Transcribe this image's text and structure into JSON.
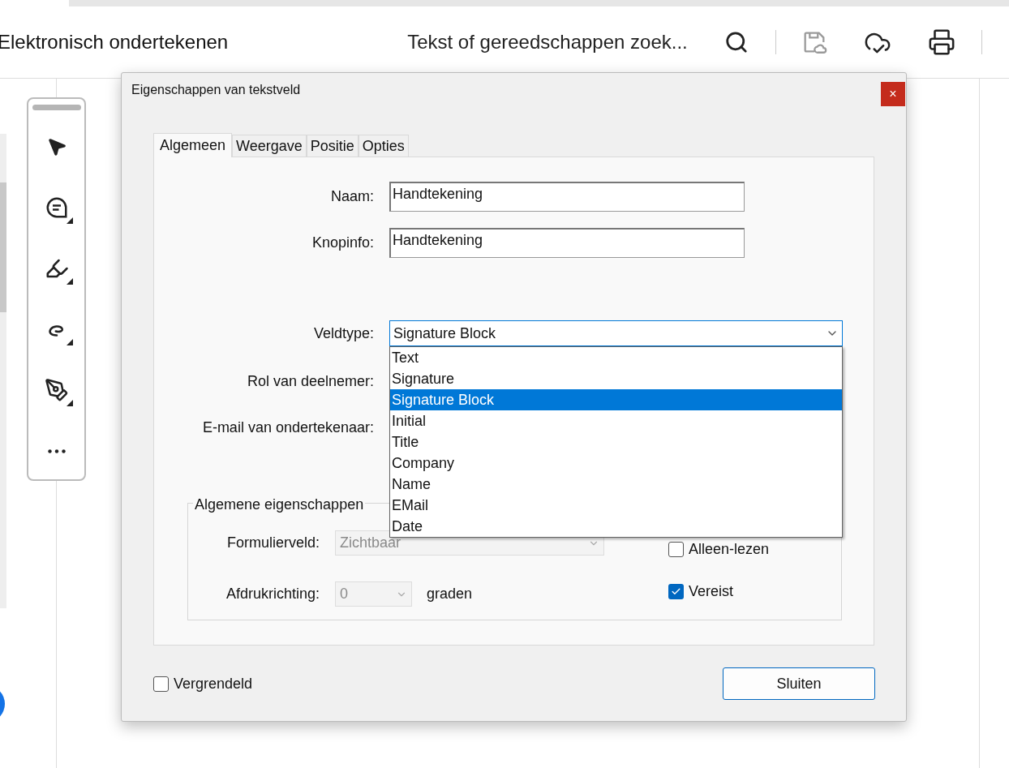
{
  "app": {
    "title": "Elektronisch ondertekenen",
    "search": {
      "placeholder": "Tekst of gereedschappen zoek..."
    }
  },
  "dialog": {
    "title": "Eigenschappen van tekstveld",
    "close": "×",
    "tabs": [
      {
        "label": "Algemeen",
        "selected": true
      },
      {
        "label": "Weergave",
        "selected": false
      },
      {
        "label": "Positie",
        "selected": false
      },
      {
        "label": "Opties",
        "selected": false
      }
    ],
    "fields": [
      {
        "label": "Naam:",
        "value": "Handtekening"
      },
      {
        "label": "Knopinfo:",
        "value": "Handtekening"
      }
    ],
    "field_type": {
      "label": "Veldtype:",
      "value": "Signature Block",
      "expanded": true,
      "options": [
        {
          "label": "Text",
          "selected": false
        },
        {
          "label": "Signature",
          "selected": false
        },
        {
          "label": "Signature Block",
          "selected": true
        },
        {
          "label": "Initial",
          "selected": false
        },
        {
          "label": "Title",
          "selected": false
        },
        {
          "label": "Company",
          "selected": false
        },
        {
          "label": "Name",
          "selected": false
        },
        {
          "label": "EMail",
          "selected": false
        },
        {
          "label": "Date",
          "selected": false
        }
      ]
    },
    "covered_fields": [
      {
        "label": "Rol van deelnemer:"
      },
      {
        "label": "E-mail van ondertekenaar:"
      }
    ],
    "group": {
      "title": "Algemene eigenschappen",
      "form_field": {
        "label": "Formulierveld:",
        "value": "Zichtbaar",
        "disabled": true
      },
      "orientation": {
        "label": "Afdrukrichting:",
        "value": "0",
        "unit": "graden",
        "disabled": true
      },
      "checkboxes": [
        {
          "label": "Alleen-lezen",
          "checked": false
        },
        {
          "label": "Vereist",
          "checked": true
        }
      ]
    },
    "locked": {
      "label": "Vergrendeld",
      "checked": false
    },
    "close_button": "Sluiten"
  }
}
